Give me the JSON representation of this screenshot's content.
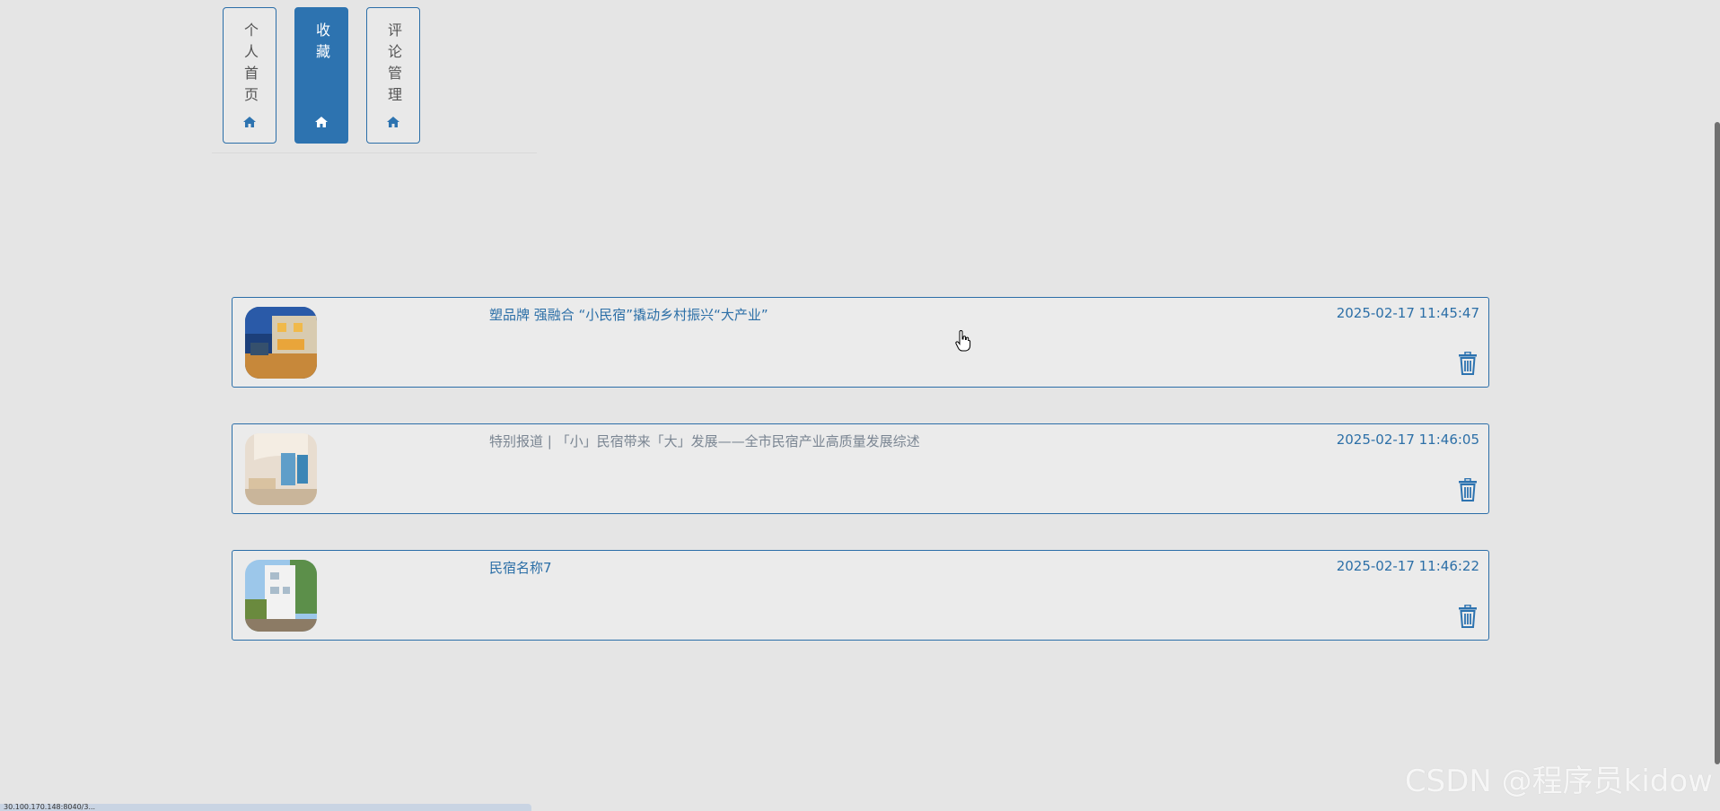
{
  "nav": {
    "tabs": [
      {
        "label": "个人首页",
        "active": false
      },
      {
        "label": "收藏",
        "active": true
      },
      {
        "label": "评论管理",
        "active": false
      }
    ]
  },
  "favorites": [
    {
      "title": "塑品牌 强融合 “小民宿”撬动乡村振兴“大产业”",
      "time": "2025-02-17 11:45:47"
    },
    {
      "title": "特别报道 | 「小」民宿带来「大」发展——全市民宿产业高质量发展综述",
      "time": "2025-02-17 11:46:05"
    },
    {
      "title": "民宿名称7",
      "time": "2025-02-17 11:46:22"
    }
  ],
  "status_bar": {
    "url": "30.100.170.148:8040/3..."
  },
  "watermark": "CSDN @程序员kidow",
  "colors": {
    "accent": "#2d73b0",
    "border": "#2b6ea8",
    "background": "#e5e5e5"
  }
}
